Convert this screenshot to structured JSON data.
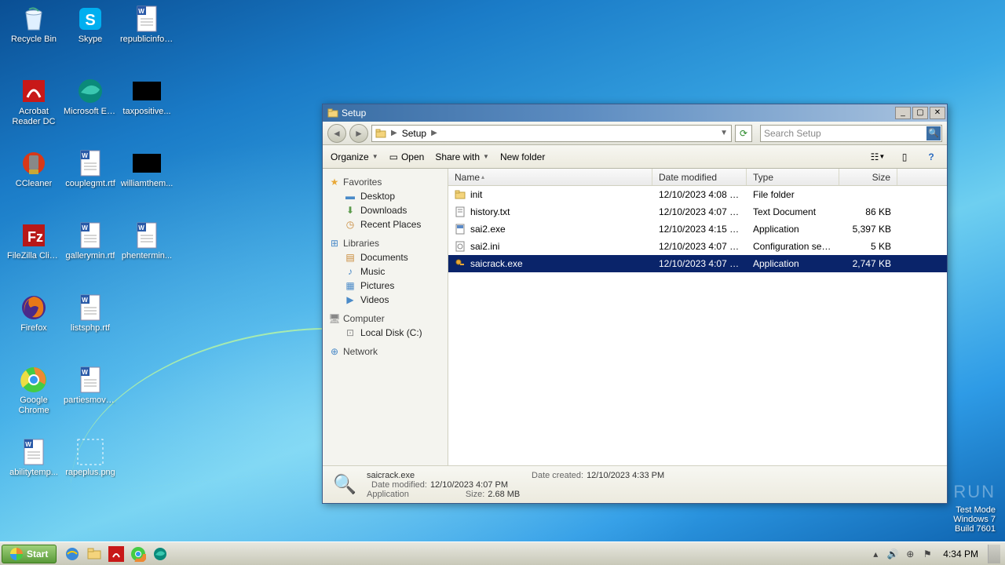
{
  "desktop": {
    "icons": [
      {
        "label": "Recycle Bin",
        "icon": "recycle-bin"
      },
      {
        "label": "Skype",
        "icon": "skype"
      },
      {
        "label": "republicinfo.rtf",
        "icon": "word-doc"
      },
      {
        "label": "Acrobat Reader DC",
        "icon": "acrobat",
        "two": true
      },
      {
        "label": "Microsoft Edge",
        "icon": "edge"
      },
      {
        "label": "taxpositive...",
        "icon": "black-png"
      },
      {
        "label": "CCleaner",
        "icon": "ccleaner"
      },
      {
        "label": "couplegmt.rtf",
        "icon": "word-doc"
      },
      {
        "label": "williamthem...",
        "icon": "black-png"
      },
      {
        "label": "FileZilla Client",
        "icon": "filezilla"
      },
      {
        "label": "gallerymin.rtf",
        "icon": "word-doc"
      },
      {
        "label": "phentermin...",
        "icon": "word-doc"
      },
      {
        "label": "Firefox",
        "icon": "firefox"
      },
      {
        "label": "listsphp.rtf",
        "icon": "word-doc"
      },
      {
        "label": "",
        "icon": "blank"
      },
      {
        "label": "Google Chrome",
        "icon": "chrome",
        "two": true
      },
      {
        "label": "partiesmove...",
        "icon": "word-doc"
      },
      {
        "label": "",
        "icon": "blank"
      },
      {
        "label": "abilitytemp...",
        "icon": "word-doc"
      },
      {
        "label": "rapeplus.png",
        "icon": "dashed"
      }
    ]
  },
  "watermark": {
    "line1": "Test Mode",
    "line2": "Windows 7",
    "line3": "Build 7601"
  },
  "anyrun": "ANY ▷ RUN",
  "window": {
    "title": "Setup",
    "breadcrumb": "Setup",
    "search_placeholder": "Search Setup",
    "toolbar": {
      "organize": "Organize",
      "open": "Open",
      "share": "Share with",
      "newfolder": "New folder"
    },
    "nav": {
      "favorites": "Favorites",
      "desktop": "Desktop",
      "downloads": "Downloads",
      "recent": "Recent Places",
      "libraries": "Libraries",
      "documents": "Documents",
      "music": "Music",
      "pictures": "Pictures",
      "videos": "Videos",
      "computer": "Computer",
      "localc": "Local Disk (C:)",
      "network": "Network"
    },
    "columns": {
      "name": "Name",
      "date": "Date modified",
      "type": "Type",
      "size": "Size"
    },
    "files": [
      {
        "name": "init",
        "date": "12/10/2023 4:08 PM",
        "type": "File folder",
        "size": "",
        "icon": "folder"
      },
      {
        "name": "history.txt",
        "date": "12/10/2023 4:07 PM",
        "type": "Text Document",
        "size": "86 KB",
        "icon": "txt"
      },
      {
        "name": "sai2.exe",
        "date": "12/10/2023 4:15 PM",
        "type": "Application",
        "size": "5,397 KB",
        "icon": "exe"
      },
      {
        "name": "sai2.ini",
        "date": "12/10/2023 4:07 PM",
        "type": "Configuration settings",
        "size": "5 KB",
        "icon": "ini"
      },
      {
        "name": "saicrack.exe",
        "date": "12/10/2023 4:07 PM",
        "type": "Application",
        "size": "2,747 KB",
        "icon": "exe-key",
        "selected": true
      }
    ],
    "details": {
      "name": "saicrack.exe",
      "type": "Application",
      "modified_k": "Date modified:",
      "modified_v": "12/10/2023 4:07 PM",
      "created_k": "Date created:",
      "created_v": "12/10/2023 4:33 PM",
      "size_k": "Size:",
      "size_v": "2.68 MB"
    }
  },
  "taskbar": {
    "start": "Start",
    "clock": "4:34 PM"
  }
}
